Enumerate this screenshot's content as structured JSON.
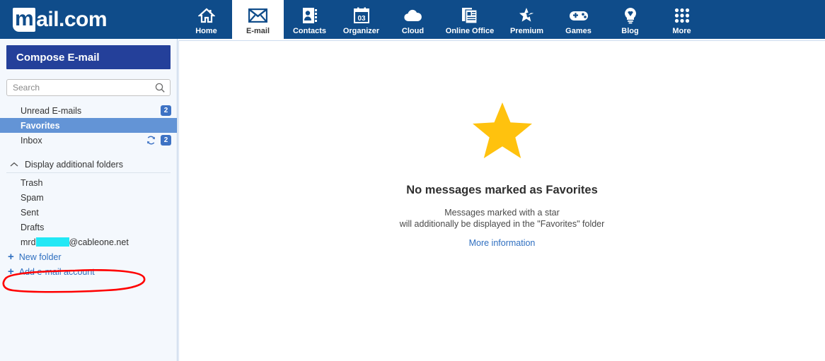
{
  "brand": {
    "logo_m": "m",
    "logo_text": "ail.com",
    "header_color": "#0f4c8a",
    "accent_blue": "#24409a",
    "selected_blue": "#6394d6",
    "badge_blue": "#3d72c4",
    "link_blue": "#2f6fc0",
    "star_gold": "#ffc20e",
    "annotation_red": "#ff0000",
    "redaction_cyan": "#22e8f5"
  },
  "nav": {
    "items": [
      {
        "label": "Home",
        "icon": "home-icon",
        "active": false
      },
      {
        "label": "E-mail",
        "icon": "envelope-icon",
        "active": true
      },
      {
        "label": "Contacts",
        "icon": "contacts-icon",
        "active": false
      },
      {
        "label": "Organizer",
        "icon": "calendar-icon",
        "active": false
      },
      {
        "label": "Cloud",
        "icon": "cloud-icon",
        "active": false
      },
      {
        "label": "Online Office",
        "icon": "documents-icon",
        "active": false
      },
      {
        "label": "Premium",
        "icon": "star-swoosh-icon",
        "active": false
      },
      {
        "label": "Games",
        "icon": "gamepad-icon",
        "active": false
      },
      {
        "label": "Blog",
        "icon": "lightbulb-icon",
        "active": false
      },
      {
        "label": "More",
        "icon": "grid-dots-icon",
        "active": false
      }
    ],
    "calendar_day": "03"
  },
  "sidebar": {
    "compose_label": "Compose E-mail",
    "search": {
      "placeholder": "Search",
      "value": "",
      "icon": "search-icon"
    },
    "folders": [
      {
        "label": "Unread E-mails",
        "badge": "2",
        "selected": false,
        "refresh": false
      },
      {
        "label": "Favorites",
        "badge": "",
        "selected": true,
        "refresh": false
      },
      {
        "label": "Inbox",
        "badge": "2",
        "selected": false,
        "refresh": true
      }
    ],
    "additional_folders_label": "Display additional folders",
    "additional_folders_icon": "chevron-up-icon",
    "subfolders": [
      {
        "label": "Trash"
      },
      {
        "label": "Spam"
      },
      {
        "label": "Sent"
      },
      {
        "label": "Drafts"
      }
    ],
    "account": {
      "prefix": "mrd",
      "suffix": "@cableone.net",
      "redacted": true,
      "annotated": true
    },
    "actions": [
      {
        "label": "New folder",
        "icon": "plus-icon"
      },
      {
        "label": "Add e-mail account",
        "icon": "plus-icon"
      }
    ]
  },
  "main": {
    "empty_state": {
      "icon": "star-icon",
      "title": "No messages marked as Favorites",
      "body_line1": "Messages marked with a star",
      "body_line2": "will additionally be displayed in the \"Favorites\" folder",
      "link_label": "More information"
    }
  }
}
